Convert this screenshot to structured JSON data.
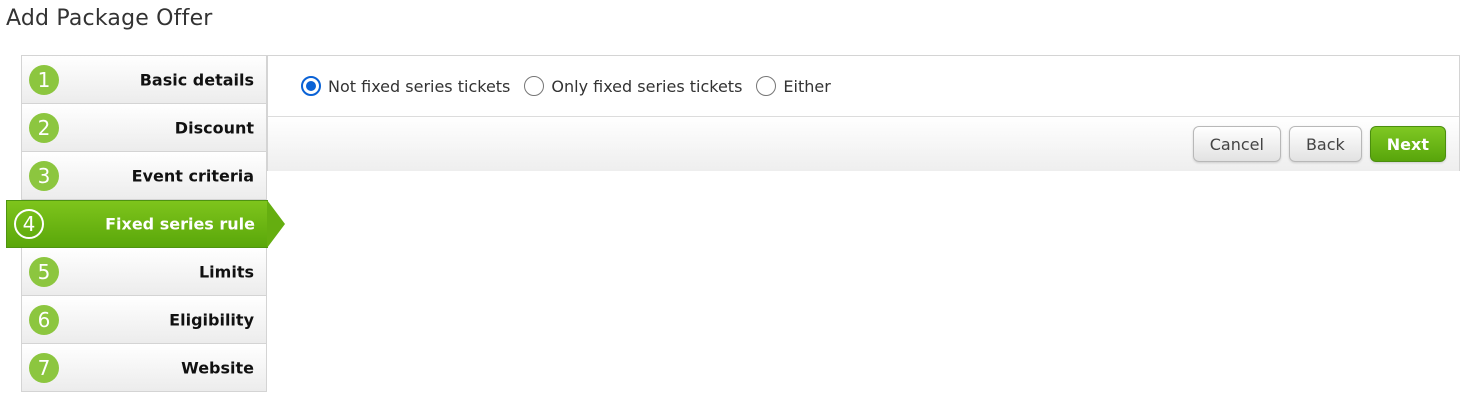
{
  "page": {
    "title": "Add Package Offer"
  },
  "steps": [
    {
      "number": "1",
      "label": "Basic details",
      "active": false
    },
    {
      "number": "2",
      "label": "Discount",
      "active": false
    },
    {
      "number": "3",
      "label": "Event criteria",
      "active": false
    },
    {
      "number": "4",
      "label": "Fixed series rule",
      "active": true
    },
    {
      "number": "5",
      "label": "Limits",
      "active": false
    },
    {
      "number": "6",
      "label": "Eligibility",
      "active": false
    },
    {
      "number": "7",
      "label": "Website",
      "active": false
    }
  ],
  "fixed_series": {
    "options": [
      {
        "label": "Not fixed series tickets",
        "selected": true
      },
      {
        "label": "Only fixed series tickets",
        "selected": false
      },
      {
        "label": "Either",
        "selected": false
      }
    ]
  },
  "actions": {
    "cancel_label": "Cancel",
    "back_label": "Back",
    "next_label": "Next"
  },
  "colors": {
    "accent_green": "#6cb516",
    "step_number_green": "#8cc63f",
    "radio_blue": "#0a62d6"
  }
}
